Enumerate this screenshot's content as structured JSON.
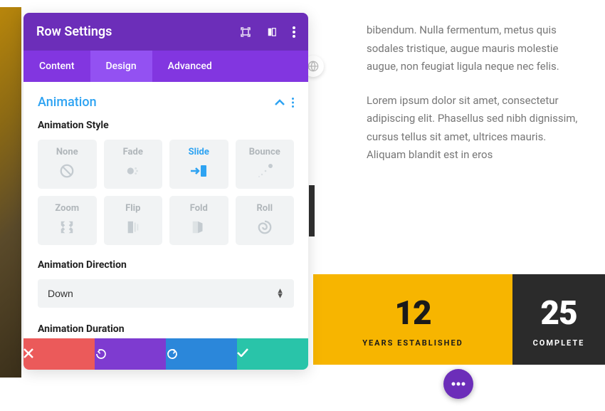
{
  "panel": {
    "title": "Row Settings",
    "tabs": [
      {
        "label": "Content",
        "active": false
      },
      {
        "label": "Design",
        "active": true
      },
      {
        "label": "Advanced",
        "active": false
      }
    ]
  },
  "section": {
    "title": "Animation"
  },
  "fields": {
    "style_label": "Animation Style",
    "direction_label": "Animation Direction",
    "duration_label": "Animation Duration",
    "direction_value": "Down"
  },
  "anim_styles": [
    {
      "label": "None",
      "icon": "none",
      "selected": false
    },
    {
      "label": "Fade",
      "icon": "fade",
      "selected": false
    },
    {
      "label": "Slide",
      "icon": "slide",
      "selected": true
    },
    {
      "label": "Bounce",
      "icon": "bounce",
      "selected": false
    },
    {
      "label": "Zoom",
      "icon": "zoom",
      "selected": false
    },
    {
      "label": "Flip",
      "icon": "flip",
      "selected": false
    },
    {
      "label": "Fold",
      "icon": "fold",
      "selected": false
    },
    {
      "label": "Roll",
      "icon": "roll",
      "selected": false
    }
  ],
  "preview": {
    "p1": "bibendum. Nulla fermentum, metus quis sodales tristique, augue mauris molestie augue, non feugiat ligula neque nec felis.",
    "p2": "Lorem ipsum dolor sit amet, consectetur adipiscing elit. Phasellus sed nibh dignissim, cursus tellus sit amet, ultrices mauris. Aliquam blandit est in eros"
  },
  "stats": [
    {
      "num": "12",
      "label": "YEARS ESTABLISHED"
    },
    {
      "num": "25",
      "label": "COMPLETE"
    }
  ]
}
